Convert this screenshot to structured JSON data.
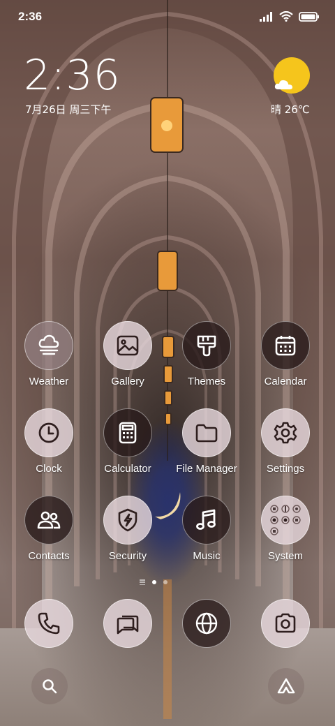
{
  "status_bar": {
    "time": "2:36",
    "icons": [
      "signal-icon",
      "wifi-icon",
      "battery-icon"
    ]
  },
  "clock_widget": {
    "time": "2:36",
    "date": "7月26日 周三下午"
  },
  "weather_widget": {
    "condition": "晴 26℃",
    "icon": "sun-cloud-icon"
  },
  "apps": [
    {
      "label": "Weather",
      "icon": "weather-icon"
    },
    {
      "label": "Gallery",
      "icon": "gallery-icon"
    },
    {
      "label": "Themes",
      "icon": "themes-brush-icon"
    },
    {
      "label": "Calendar",
      "icon": "calendar-icon"
    },
    {
      "label": "Clock",
      "icon": "clock-icon"
    },
    {
      "label": "Calculator",
      "icon": "calculator-icon"
    },
    {
      "label": "File Manager",
      "icon": "folder-icon"
    },
    {
      "label": "Settings",
      "icon": "gear-icon"
    },
    {
      "label": "Contacts",
      "icon": "contacts-icon"
    },
    {
      "label": "Security",
      "icon": "shield-icon"
    },
    {
      "label": "Music",
      "icon": "music-note-icon"
    },
    {
      "label": "System",
      "icon": "system-folder-icon"
    }
  ],
  "page_indicator": {
    "pages": 2,
    "active": 0
  },
  "dock": [
    {
      "icon": "phone-icon"
    },
    {
      "icon": "messages-icon"
    },
    {
      "icon": "browser-globe-icon"
    },
    {
      "icon": "camera-icon"
    }
  ],
  "bottom_bar": {
    "left_icon": "search-icon",
    "right_icon": "assistant-icon"
  },
  "colors": {
    "sun": "#f5c51c",
    "icon_light": "#e8dade",
    "icon_dark": "#281a1a"
  }
}
